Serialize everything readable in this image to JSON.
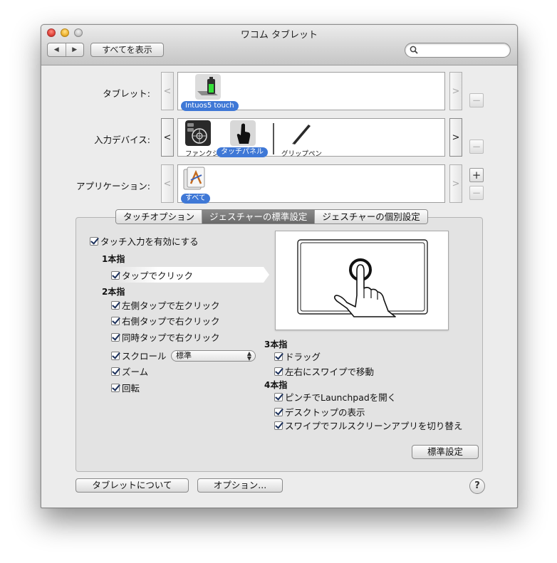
{
  "window": {
    "title": "ワコム タブレット"
  },
  "toolbar": {
    "back": "◀",
    "forward": "▶",
    "show_all": "すべてを表示",
    "search_placeholder": ""
  },
  "rows": {
    "tablet": {
      "label": "タブレット:",
      "item": "Intuos5 touch"
    },
    "input_device": {
      "label": "入力デバイス:",
      "items": [
        "ファンクション",
        "タッチパネル",
        "グリップペン"
      ]
    },
    "application": {
      "label": "アプリケーション:",
      "item": "すべて"
    }
  },
  "buttons_side": {
    "minus": "−",
    "plus": "+"
  },
  "scroll": {
    "left": "<",
    "right": ">"
  },
  "tabs": [
    "タッチオプション",
    "ジェスチャーの標準設定",
    "ジェスチャーの個別設定"
  ],
  "selected_tab": 1,
  "gestures": {
    "enable": "タッチ入力を有効にする",
    "one_finger": {
      "title": "1本指",
      "items": [
        "タップでクリック"
      ]
    },
    "two_finger": {
      "title": "2本指",
      "items": [
        "左側タップで左クリック",
        "右側タップで右クリック",
        "同時タップで右クリック",
        "スクロール",
        "ズーム",
        "回転"
      ]
    },
    "scroll_select": "標準",
    "three_finger": {
      "title": "3本指",
      "items": [
        "ドラッグ",
        "左右にスワイプで移動"
      ]
    },
    "four_finger": {
      "title": "4本指",
      "items": [
        "ピンチでLaunchpadを開く",
        "デスクトップの表示",
        "スワイプでフルスクリーンアプリを切り替え"
      ]
    },
    "default_button": "標準設定"
  },
  "footer": {
    "about": "タブレットについて",
    "options": "オプション...",
    "help": "?"
  },
  "colors": {
    "selection": "#3f78d6",
    "tab_selected": "#7a7a7a"
  }
}
